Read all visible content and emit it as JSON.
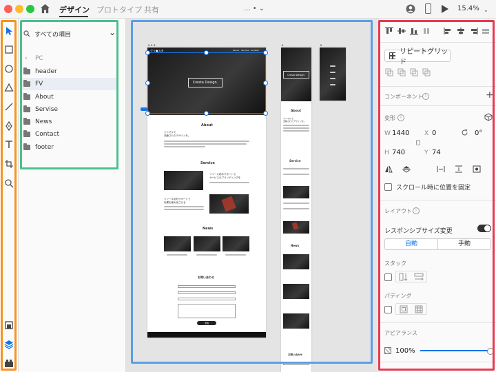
{
  "titlebar": {
    "tabs": [
      "デザイン",
      "プロトタイプ",
      "共有"
    ],
    "doc_title": "...  •  ⌄",
    "zoom": "15.4%",
    "colors": {
      "close": "#ff5f57",
      "min": "#febc2e",
      "max": "#28c840"
    }
  },
  "layers": {
    "filter_label": "すべての項目",
    "back_label": "PC",
    "items": [
      "header",
      "FV",
      "About",
      "Servise",
      "News",
      "Contact",
      "footer"
    ],
    "selected": "FV"
  },
  "artboard": {
    "brand": "クリ●スタ",
    "nav": [
      "About",
      "Service",
      "Contact"
    ],
    "hero_title": "Cresta Design.",
    "about_title": "About",
    "about_heading": "ミニマルで\n洗練されたデザインを。",
    "service_title": "Service",
    "service_1": "ソリース初めサポートで\nサービスのブランディングを",
    "service_2": "ソリース初めサポートで\n効果を最大化させる",
    "news_title": "News",
    "contact_title": "お問い合わせ",
    "send_label": "送信",
    "mobile_hero": "Cresta Design.",
    "mobile_about": "About",
    "mobile_about_heading": "ミニマルで\n洗練されたデザインを。",
    "mobile_service": "Service",
    "mobile_news": "News",
    "mobile_contact": "お問い合わせ"
  },
  "inspector": {
    "repeat_grid": "リピートグリッド",
    "component_label": "コンポーネント",
    "transform_label": "変形",
    "w_label": "W",
    "w_value": "1440",
    "x_label": "X",
    "x_value": "0",
    "rotate_value": "0°",
    "h_label": "H",
    "h_value": "740",
    "y_label": "Y",
    "y_value": "74",
    "fix_scroll": "スクロール時に位置を固定",
    "layout_label": "レイアウト",
    "responsive_label": "レスポンシブサイズ変更",
    "auto_label": "自動",
    "manual_label": "手動",
    "stack_label": "スタック",
    "padding_label": "パディング",
    "appearance_label": "アピアランス",
    "opacity_value": "100%",
    "accent": "#1473e6"
  },
  "highlight_colors": {
    "toolbar": "#f7931e",
    "layers": "#4cbf8f",
    "canvas": "#5b9ee6",
    "inspector": "#e8384f"
  }
}
